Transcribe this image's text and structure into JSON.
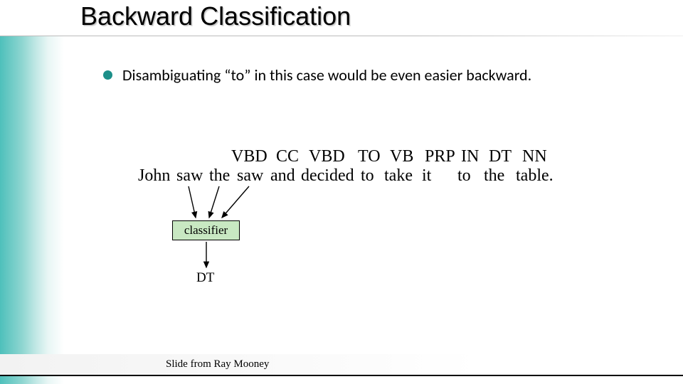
{
  "title": "Backward Classification",
  "bullet": "Disambiguating “to” in this case would be even easier backward.",
  "tags": [
    "VBD",
    "CC",
    "VBD",
    "TO",
    "VB",
    "PRP",
    "IN",
    "DT",
    "NN"
  ],
  "words": [
    "John",
    "saw",
    "the",
    "saw",
    "and",
    "decided",
    "to",
    "take",
    "it",
    "to",
    "the",
    "table."
  ],
  "classifier_label": "classifier",
  "output": "DT",
  "footer": "Slide from Ray Mooney",
  "colors": {
    "accent": "#1c8f89",
    "classifier_fill": "#c8e8c2"
  }
}
